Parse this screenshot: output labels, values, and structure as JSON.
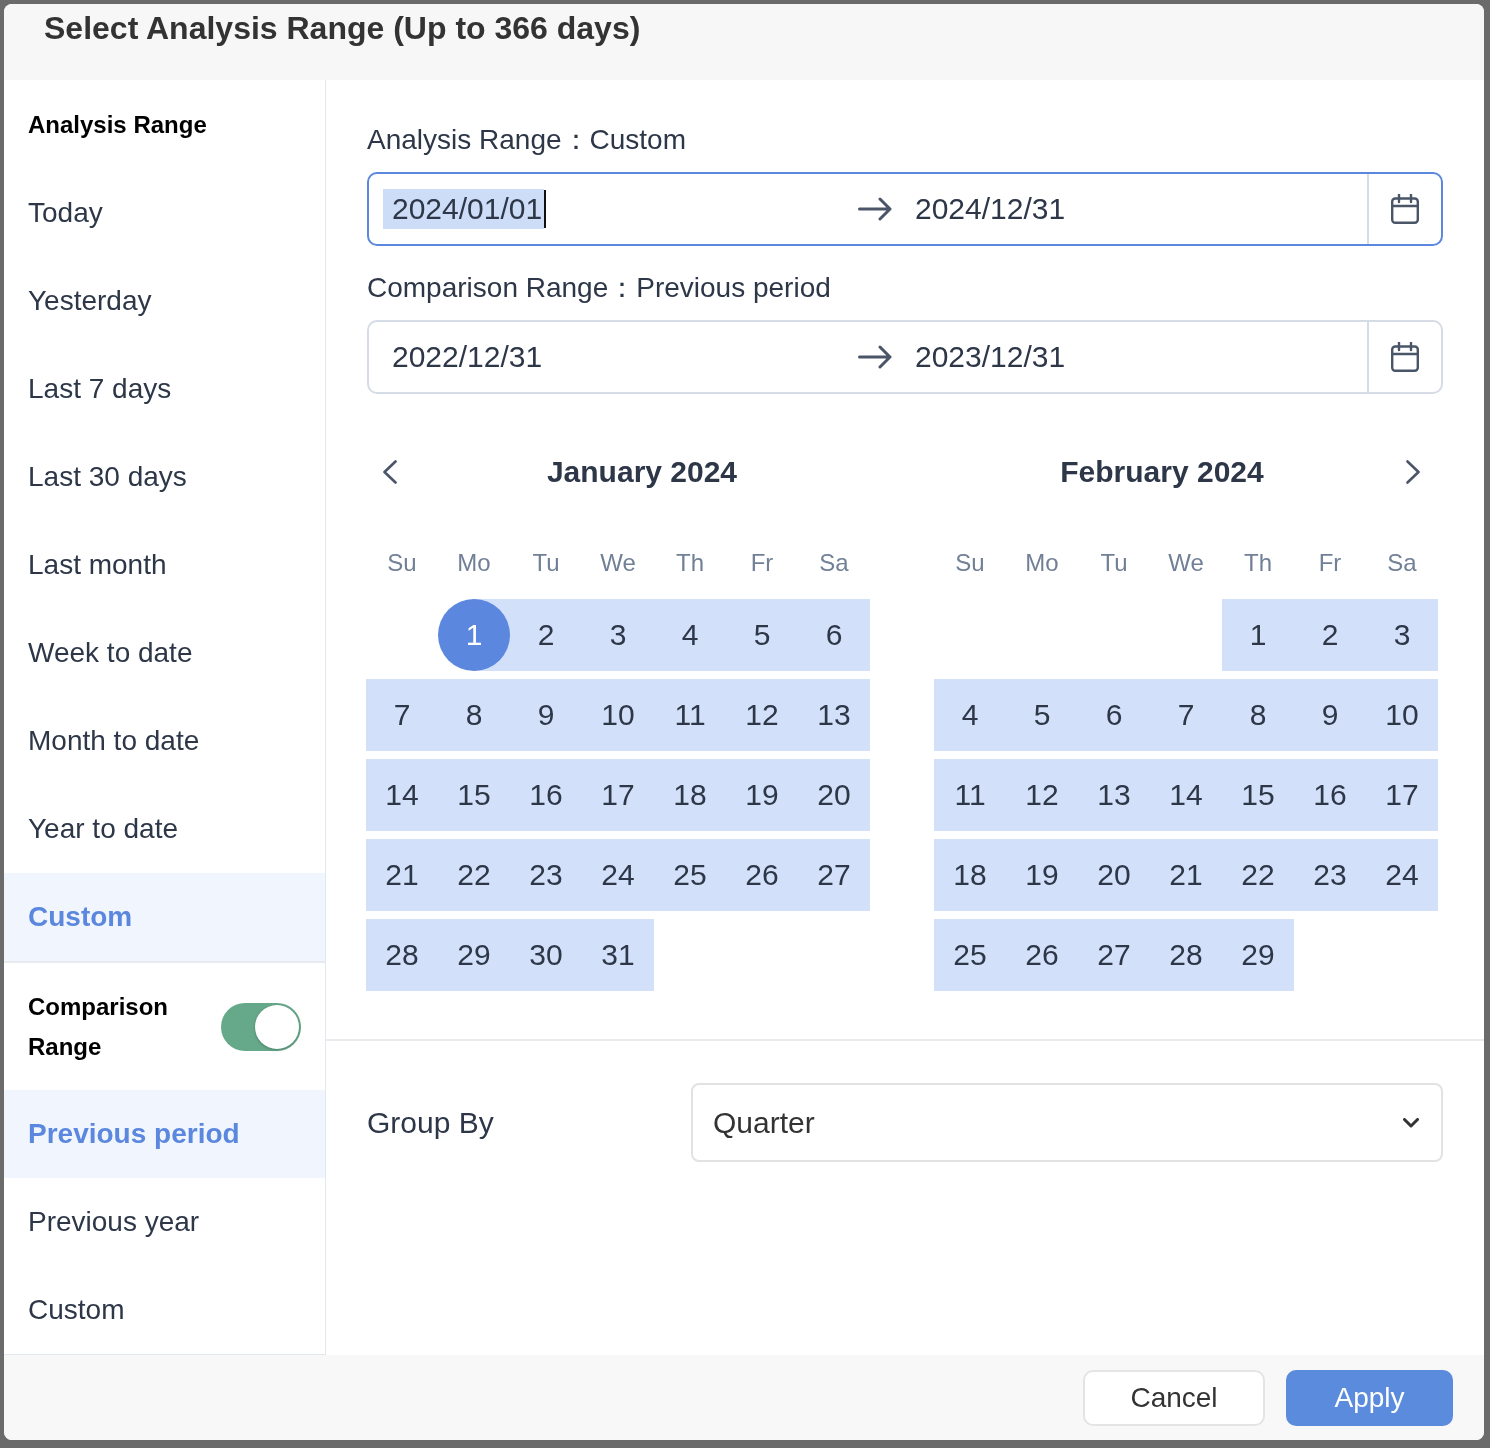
{
  "dialog": {
    "title": "Select Analysis Range (Up to 366 days)"
  },
  "sidebar": {
    "analysis_header": "Analysis Range",
    "analysis_options": [
      {
        "label": "Today",
        "selected": false
      },
      {
        "label": "Yesterday",
        "selected": false
      },
      {
        "label": "Last 7 days",
        "selected": false
      },
      {
        "label": "Last 30 days",
        "selected": false
      },
      {
        "label": "Last month",
        "selected": false
      },
      {
        "label": "Week to date",
        "selected": false
      },
      {
        "label": "Month to date",
        "selected": false
      },
      {
        "label": "Year to date",
        "selected": false
      },
      {
        "label": "Custom",
        "selected": true
      }
    ],
    "comparison_toggle": {
      "label": "Comparison Range",
      "on": true
    },
    "comparison_options": [
      {
        "label": "Previous period",
        "selected": true
      },
      {
        "label": "Previous year",
        "selected": false
      },
      {
        "label": "Custom",
        "selected": false
      }
    ]
  },
  "analysis_range": {
    "label": "Analysis Range：Custom",
    "start": "2024/01/01",
    "end": "2024/12/31",
    "focused": true,
    "start_highlighted": true
  },
  "comparison_range": {
    "label": "Comparison Range：Previous period",
    "start": "2022/12/31",
    "end": "2023/12/31",
    "focused": false,
    "start_highlighted": false
  },
  "calendars": [
    {
      "title": "January 2024",
      "weekdays": [
        "Su",
        "Mo",
        "Tu",
        "We",
        "Th",
        "Fr",
        "Sa"
      ],
      "weeks": [
        [
          {
            "label": "1",
            "selected": true,
            "in_range": true
          },
          {
            "label": "2",
            "selected": false,
            "in_range": true
          },
          {
            "label": "3",
            "selected": false,
            "in_range": true
          },
          {
            "label": "4",
            "selected": false,
            "in_range": true
          },
          {
            "label": "5",
            "selected": false,
            "in_range": true
          },
          {
            "label": "6",
            "selected": false,
            "in_range": true
          }
        ],
        [
          {
            "label": "7",
            "selected": false,
            "in_range": true
          },
          {
            "label": "8",
            "selected": false,
            "in_range": true
          },
          {
            "label": "9",
            "selected": false,
            "in_range": true
          },
          {
            "label": "10",
            "selected": false,
            "in_range": true
          },
          {
            "label": "11",
            "selected": false,
            "in_range": true
          },
          {
            "label": "12",
            "selected": false,
            "in_range": true
          },
          {
            "label": "13",
            "selected": false,
            "in_range": true
          }
        ],
        [
          {
            "label": "14",
            "selected": false,
            "in_range": true
          },
          {
            "label": "15",
            "selected": false,
            "in_range": true
          },
          {
            "label": "16",
            "selected": false,
            "in_range": true
          },
          {
            "label": "17",
            "selected": false,
            "in_range": true
          },
          {
            "label": "18",
            "selected": false,
            "in_range": true
          },
          {
            "label": "19",
            "selected": false,
            "in_range": true
          },
          {
            "label": "20",
            "selected": false,
            "in_range": true
          }
        ],
        [
          {
            "label": "21",
            "selected": false,
            "in_range": true
          },
          {
            "label": "22",
            "selected": false,
            "in_range": true
          },
          {
            "label": "23",
            "selected": false,
            "in_range": true
          },
          {
            "label": "24",
            "selected": false,
            "in_range": true
          },
          {
            "label": "25",
            "selected": false,
            "in_range": true
          },
          {
            "label": "26",
            "selected": false,
            "in_range": true
          },
          {
            "label": "27",
            "selected": false,
            "in_range": true
          }
        ],
        [
          {
            "label": "28",
            "selected": false,
            "in_range": true
          },
          {
            "label": "29",
            "selected": false,
            "in_range": true
          },
          {
            "label": "30",
            "selected": false,
            "in_range": true
          },
          {
            "label": "31",
            "selected": false,
            "in_range": true
          }
        ]
      ]
    },
    {
      "title": "February 2024",
      "weekdays": [
        "Su",
        "Mo",
        "Tu",
        "We",
        "Th",
        "Fr",
        "Sa"
      ],
      "weeks": [
        [
          {
            "label": "1",
            "selected": false,
            "in_range": true
          },
          {
            "label": "2",
            "selected": false,
            "in_range": true
          },
          {
            "label": "3",
            "selected": false,
            "in_range": true
          }
        ],
        [
          {
            "label": "4",
            "selected": false,
            "in_range": true
          },
          {
            "label": "5",
            "selected": false,
            "in_range": true
          },
          {
            "label": "6",
            "selected": false,
            "in_range": true
          },
          {
            "label": "7",
            "selected": false,
            "in_range": true
          },
          {
            "label": "8",
            "selected": false,
            "in_range": true
          },
          {
            "label": "9",
            "selected": false,
            "in_range": true
          },
          {
            "label": "10",
            "selected": false,
            "in_range": true
          }
        ],
        [
          {
            "label": "11",
            "selected": false,
            "in_range": true
          },
          {
            "label": "12",
            "selected": false,
            "in_range": true
          },
          {
            "label": "13",
            "selected": false,
            "in_range": true
          },
          {
            "label": "14",
            "selected": false,
            "in_range": true
          },
          {
            "label": "15",
            "selected": false,
            "in_range": true
          },
          {
            "label": "16",
            "selected": false,
            "in_range": true
          },
          {
            "label": "17",
            "selected": false,
            "in_range": true
          }
        ],
        [
          {
            "label": "18",
            "selected": false,
            "in_range": true
          },
          {
            "label": "19",
            "selected": false,
            "in_range": true
          },
          {
            "label": "20",
            "selected": false,
            "in_range": true
          },
          {
            "label": "21",
            "selected": false,
            "in_range": true
          },
          {
            "label": "22",
            "selected": false,
            "in_range": true
          },
          {
            "label": "23",
            "selected": false,
            "in_range": true
          },
          {
            "label": "24",
            "selected": false,
            "in_range": true
          }
        ],
        [
          {
            "label": "25",
            "selected": false,
            "in_range": true
          },
          {
            "label": "26",
            "selected": false,
            "in_range": true
          },
          {
            "label": "27",
            "selected": false,
            "in_range": true
          },
          {
            "label": "28",
            "selected": false,
            "in_range": true
          },
          {
            "label": "29",
            "selected": false,
            "in_range": true
          }
        ]
      ]
    }
  ],
  "group_by": {
    "label": "Group By",
    "value": "Quarter"
  },
  "buttons": [
    {
      "label": "Cancel",
      "kind": "secondary"
    },
    {
      "label": "Apply",
      "kind": "primary"
    }
  ]
}
